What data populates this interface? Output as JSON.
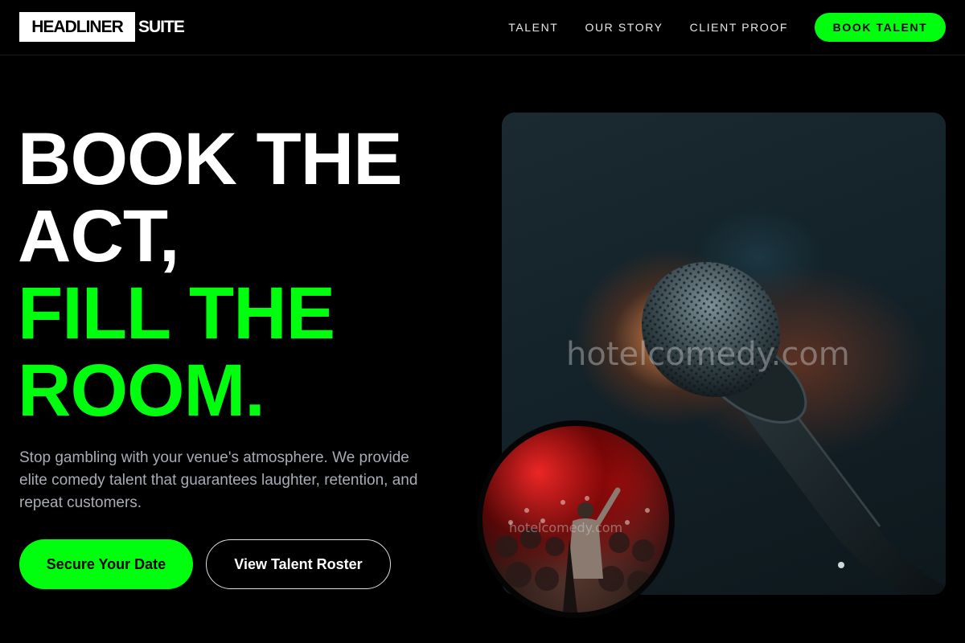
{
  "header": {
    "logo_primary": "HEADLINER",
    "logo_secondary": "SUITE",
    "nav": [
      {
        "label": "TALENT"
      },
      {
        "label": "OUR STORY"
      },
      {
        "label": "CLIENT PROOF"
      }
    ],
    "cta_label": "BOOK TALENT"
  },
  "hero": {
    "headline_line1": "BOOK THE",
    "headline_line2": "ACT,",
    "headline_line3": "FILL THE",
    "headline_line4": "ROOM.",
    "subtext": "Stop gambling with your venue's atmosphere. We provide elite comedy talent that guarantees laughter, retention, and repeat customers.",
    "primary_button": "Secure Your Date",
    "secondary_button": "View Talent Roster"
  },
  "media": {
    "main_watermark": "hotelcomedy.com",
    "crowd_watermark": "hotelcomedy.com"
  },
  "colors": {
    "accent": "#00ff0f",
    "background": "#000000",
    "muted_text": "#a8acb6"
  }
}
